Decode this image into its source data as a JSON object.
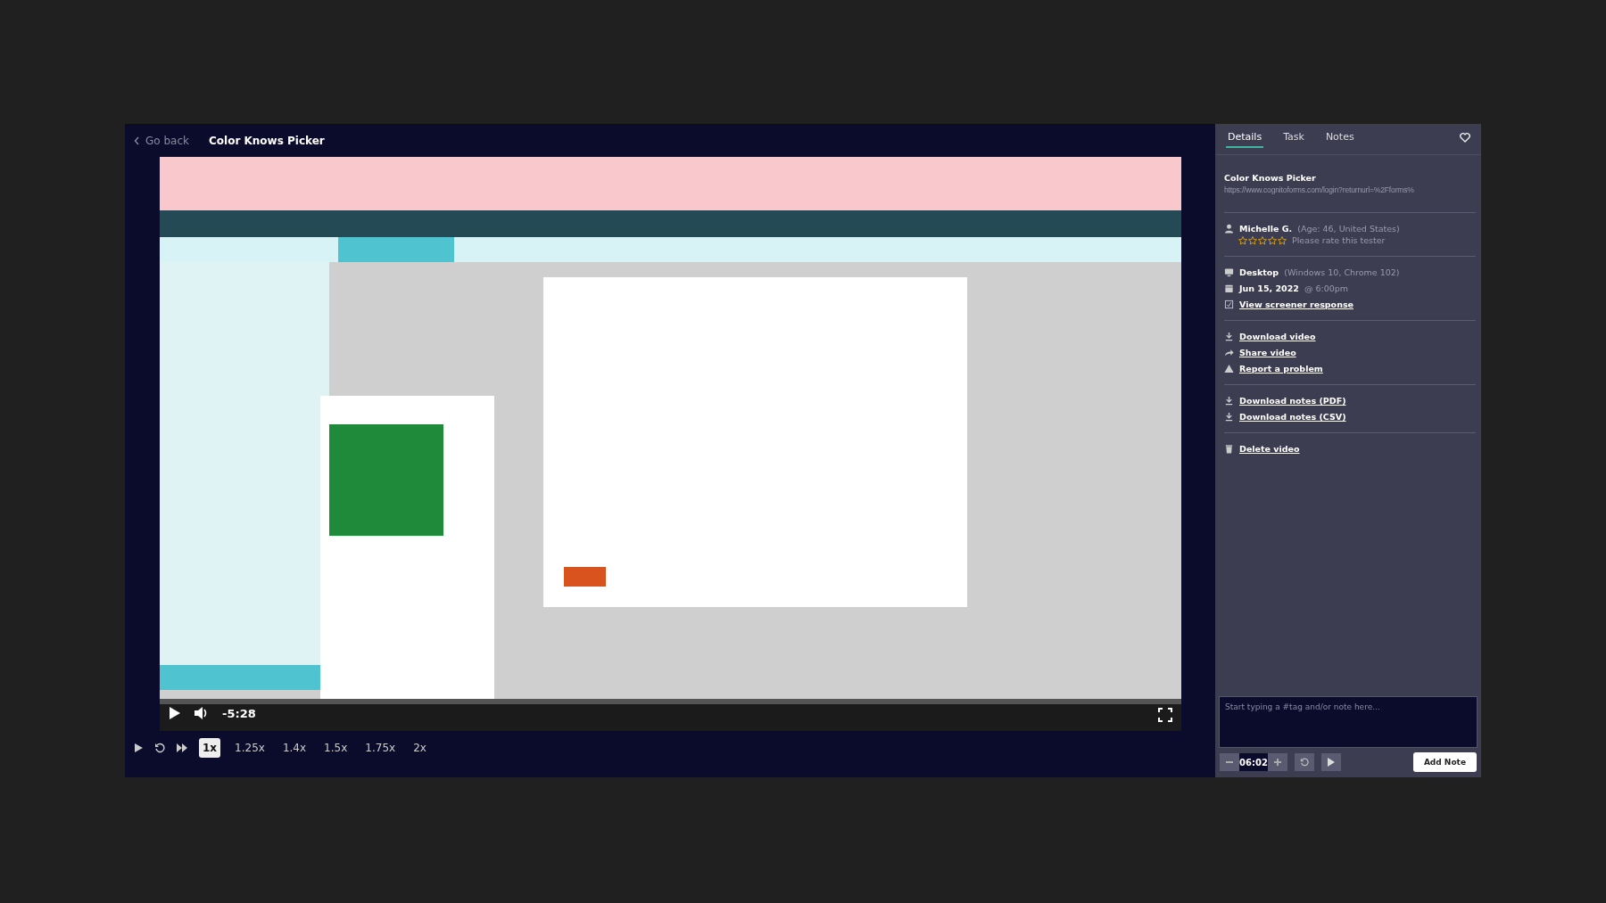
{
  "header": {
    "back": "Go back",
    "title": "Color Knows Picker"
  },
  "player": {
    "time": "-5:28",
    "speeds": [
      {
        "label": "1x",
        "selected": true
      },
      {
        "label": "1.25x",
        "selected": false
      },
      {
        "label": "1.4x",
        "selected": false
      },
      {
        "label": "1.5x",
        "selected": false
      },
      {
        "label": "1.75x",
        "selected": false
      },
      {
        "label": "2x",
        "selected": false
      }
    ]
  },
  "tabs": [
    {
      "label": "Details",
      "selected": true
    },
    {
      "label": "Task",
      "selected": false
    },
    {
      "label": "Notes",
      "selected": false
    }
  ],
  "details": {
    "title": "Color Knows Picker",
    "url": "https://www.cognitoforms.com/login?returnurl=%2Fforms%",
    "tester": {
      "name": "Michelle G.",
      "info": "(Age: 46, United States)",
      "stars": 0,
      "rating_hint": "Please rate this tester"
    },
    "device": {
      "name": "Desktop",
      "info": "(Windows 10, Chrome 102)"
    },
    "date": {
      "value": "Jun 15, 2022",
      "time": "@ 6:00pm"
    },
    "screener_link": "View screener response",
    "actions": [
      {
        "kind": "download",
        "label": "Download video"
      },
      {
        "kind": "share",
        "label": "Share video"
      },
      {
        "kind": "warning",
        "label": "Report a problem"
      }
    ],
    "notes_actions": [
      {
        "kind": "download",
        "label": "Download notes (PDF)"
      },
      {
        "kind": "download",
        "label": "Download notes (CSV)"
      }
    ],
    "delete": "Delete video"
  },
  "note": {
    "placeholder": "Start typing a #tag and/or note here...",
    "timestamp": "06:02",
    "button": "Add Note"
  }
}
